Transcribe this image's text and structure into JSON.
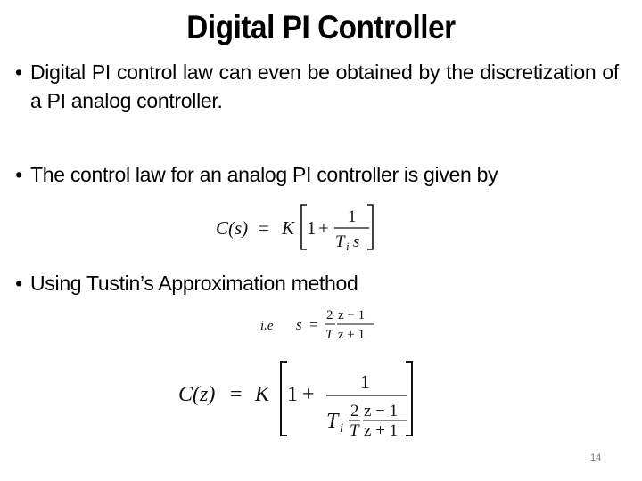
{
  "slide": {
    "title": "Digital PI Controller",
    "bullets": [
      {
        "marker": "•",
        "text": "Digital PI control law can even be obtained by the discretization of a PI analog controller."
      },
      {
        "marker": "•",
        "text": "The control law for an analog PI controller is given by"
      },
      {
        "marker": "•",
        "text": "Using Tustin’s Approximation method"
      }
    ],
    "equations": {
      "analog_pi": {
        "lhs": "C(s)",
        "equals": "=",
        "gain": "K",
        "one": "1",
        "plus": "+",
        "numerator": "1",
        "denominator_T": "T",
        "denominator_sub": "i",
        "denominator_var": "s",
        "latex": "C(s) = K\\left[1 + \\frac{1}{T_i s}\\right]"
      },
      "tustin": {
        "prefix": "i.e",
        "lhs": "s",
        "equals": "=",
        "frac1_num": "2",
        "frac1_den": "T",
        "frac2_num": "z − 1",
        "frac2_den": "z + 1",
        "latex": "i.e\\quad s = \\frac{2}{T}\\frac{z-1}{z+1}"
      },
      "digital_pi": {
        "lhs": "C(z)",
        "equals": "=",
        "gain": "K",
        "one": "1",
        "plus": "+",
        "numerator": "1",
        "den_T": "T",
        "den_sub": "i",
        "den_frac1_num": "2",
        "den_frac1_den": "T",
        "den_frac2_num": "z − 1",
        "den_frac2_den": "z + 1",
        "latex": "C(z) = K\\left[1 + \\frac{1}{T_i \\frac{2}{T}\\frac{z-1}{z+1}}\\right]"
      }
    },
    "page_number": "14"
  }
}
